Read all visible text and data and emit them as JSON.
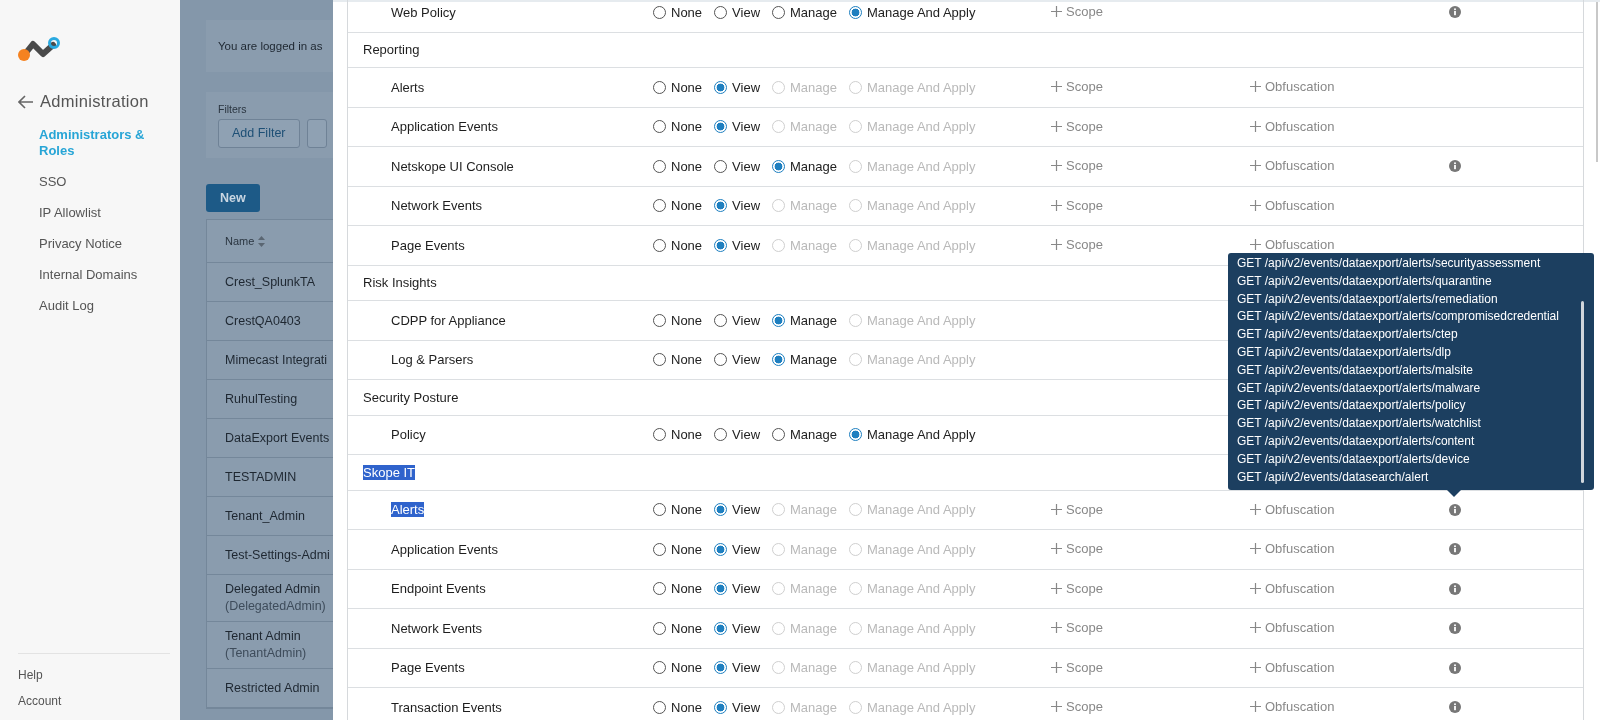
{
  "sidebar": {
    "title": "Administration",
    "items": [
      {
        "label": "Administrators & Roles",
        "selected": true
      },
      {
        "label": "SSO",
        "selected": false
      },
      {
        "label": "IP Allowlist",
        "selected": false
      },
      {
        "label": "Privacy Notice",
        "selected": false
      },
      {
        "label": "Internal Domains",
        "selected": false
      },
      {
        "label": "Audit Log",
        "selected": false
      }
    ],
    "footer_links": [
      "Help",
      "Account"
    ]
  },
  "background_page": {
    "login_notice": "You are logged in as",
    "filters_label": "Filters",
    "add_filter_button": "Add Filter",
    "new_button": "New",
    "name_column": "Name",
    "rows": [
      [
        "Crest_SplunkTA"
      ],
      [
        "CrestQA0403"
      ],
      [
        "Mimecast Integrati"
      ],
      [
        "RuhulTesting"
      ],
      [
        "DataExport Events"
      ],
      [
        "TESTADMIN"
      ],
      [
        "Tenant_Admin"
      ],
      [
        "Test-Settings-Admi"
      ],
      [
        "Delegated Admin",
        "(DelegatedAdmin)"
      ],
      [
        "Tenant Admin",
        "(TenantAdmin)"
      ],
      [
        "Restricted Admin"
      ]
    ]
  },
  "permissions": [
    {
      "kind": "item",
      "label": "Web Policy",
      "highlighted": false,
      "options": [
        {
          "label": "None",
          "selected": false,
          "disabled": false
        },
        {
          "label": "View",
          "selected": false,
          "disabled": false
        },
        {
          "label": "Manage",
          "selected": false,
          "disabled": false
        },
        {
          "label": "Manage And Apply",
          "selected": true,
          "disabled": false
        }
      ],
      "scope": "Scope",
      "info": true
    },
    {
      "kind": "group",
      "label": "Reporting",
      "highlighted": false
    },
    {
      "kind": "item",
      "label": "Alerts",
      "highlighted": false,
      "options": [
        {
          "label": "None",
          "selected": false,
          "disabled": false
        },
        {
          "label": "View",
          "selected": true,
          "disabled": false
        },
        {
          "label": "Manage",
          "selected": false,
          "disabled": true
        },
        {
          "label": "Manage And Apply",
          "selected": false,
          "disabled": true
        }
      ],
      "scope": "Scope",
      "obfuscation": "Obfuscation",
      "info": false
    },
    {
      "kind": "item",
      "label": "Application Events",
      "highlighted": false,
      "options": [
        {
          "label": "None",
          "selected": false,
          "disabled": false
        },
        {
          "label": "View",
          "selected": true,
          "disabled": false
        },
        {
          "label": "Manage",
          "selected": false,
          "disabled": true
        },
        {
          "label": "Manage And Apply",
          "selected": false,
          "disabled": true
        }
      ],
      "scope": "Scope",
      "obfuscation": "Obfuscation",
      "info": false
    },
    {
      "kind": "item",
      "label": "Netskope UI Console",
      "highlighted": false,
      "options": [
        {
          "label": "None",
          "selected": false,
          "disabled": false
        },
        {
          "label": "View",
          "selected": false,
          "disabled": false
        },
        {
          "label": "Manage",
          "selected": true,
          "disabled": false
        },
        {
          "label": "Manage And Apply",
          "selected": false,
          "disabled": true
        }
      ],
      "scope": "Scope",
      "obfuscation": "Obfuscation",
      "info": true
    },
    {
      "kind": "item",
      "label": "Network Events",
      "highlighted": false,
      "options": [
        {
          "label": "None",
          "selected": false,
          "disabled": false
        },
        {
          "label": "View",
          "selected": true,
          "disabled": false
        },
        {
          "label": "Manage",
          "selected": false,
          "disabled": true
        },
        {
          "label": "Manage And Apply",
          "selected": false,
          "disabled": true
        }
      ],
      "scope": "Scope",
      "obfuscation": "Obfuscation",
      "info": false
    },
    {
      "kind": "item",
      "label": "Page Events",
      "highlighted": false,
      "options": [
        {
          "label": "None",
          "selected": false,
          "disabled": false
        },
        {
          "label": "View",
          "selected": true,
          "disabled": false
        },
        {
          "label": "Manage",
          "selected": false,
          "disabled": true
        },
        {
          "label": "Manage And Apply",
          "selected": false,
          "disabled": true
        }
      ],
      "scope": "Scope",
      "obfuscation": "Obfuscation",
      "info": false
    },
    {
      "kind": "group",
      "label": "Risk Insights",
      "highlighted": false
    },
    {
      "kind": "item",
      "label": "CDPP for Appliance",
      "highlighted": false,
      "options": [
        {
          "label": "None",
          "selected": false,
          "disabled": false
        },
        {
          "label": "View",
          "selected": false,
          "disabled": false
        },
        {
          "label": "Manage",
          "selected": true,
          "disabled": false
        },
        {
          "label": "Manage And Apply",
          "selected": false,
          "disabled": true
        }
      ],
      "info": false
    },
    {
      "kind": "item",
      "label": "Log & Parsers",
      "highlighted": false,
      "options": [
        {
          "label": "None",
          "selected": false,
          "disabled": false
        },
        {
          "label": "View",
          "selected": false,
          "disabled": false
        },
        {
          "label": "Manage",
          "selected": true,
          "disabled": false
        },
        {
          "label": "Manage And Apply",
          "selected": false,
          "disabled": true
        }
      ],
      "info": false
    },
    {
      "kind": "group",
      "label": "Security Posture",
      "highlighted": false
    },
    {
      "kind": "item",
      "label": "Policy",
      "highlighted": false,
      "options": [
        {
          "label": "None",
          "selected": false,
          "disabled": false
        },
        {
          "label": "View",
          "selected": false,
          "disabled": false
        },
        {
          "label": "Manage",
          "selected": false,
          "disabled": false
        },
        {
          "label": "Manage And Apply",
          "selected": true,
          "disabled": false
        }
      ],
      "info": false
    },
    {
      "kind": "group",
      "label": "Skope IT",
      "highlighted": true
    },
    {
      "kind": "item",
      "label": "Alerts",
      "highlighted": true,
      "options": [
        {
          "label": "None",
          "selected": false,
          "disabled": false
        },
        {
          "label": "View",
          "selected": true,
          "disabled": false
        },
        {
          "label": "Manage",
          "selected": false,
          "disabled": true
        },
        {
          "label": "Manage And Apply",
          "selected": false,
          "disabled": true
        }
      ],
      "scope": "Scope",
      "obfuscation": "Obfuscation",
      "info": true
    },
    {
      "kind": "item",
      "label": "Application Events",
      "highlighted": false,
      "options": [
        {
          "label": "None",
          "selected": false,
          "disabled": false
        },
        {
          "label": "View",
          "selected": true,
          "disabled": false
        },
        {
          "label": "Manage",
          "selected": false,
          "disabled": true
        },
        {
          "label": "Manage And Apply",
          "selected": false,
          "disabled": true
        }
      ],
      "scope": "Scope",
      "obfuscation": "Obfuscation",
      "info": true
    },
    {
      "kind": "item",
      "label": "Endpoint Events",
      "highlighted": false,
      "options": [
        {
          "label": "None",
          "selected": false,
          "disabled": false
        },
        {
          "label": "View",
          "selected": true,
          "disabled": false
        },
        {
          "label": "Manage",
          "selected": false,
          "disabled": true
        },
        {
          "label": "Manage And Apply",
          "selected": false,
          "disabled": true
        }
      ],
      "scope": "Scope",
      "obfuscation": "Obfuscation",
      "info": true
    },
    {
      "kind": "item",
      "label": "Network Events",
      "highlighted": false,
      "options": [
        {
          "label": "None",
          "selected": false,
          "disabled": false
        },
        {
          "label": "View",
          "selected": true,
          "disabled": false
        },
        {
          "label": "Manage",
          "selected": false,
          "disabled": true
        },
        {
          "label": "Manage And Apply",
          "selected": false,
          "disabled": true
        }
      ],
      "scope": "Scope",
      "obfuscation": "Obfuscation",
      "info": true
    },
    {
      "kind": "item",
      "label": "Page Events",
      "highlighted": false,
      "options": [
        {
          "label": "None",
          "selected": false,
          "disabled": false
        },
        {
          "label": "View",
          "selected": true,
          "disabled": false
        },
        {
          "label": "Manage",
          "selected": false,
          "disabled": true
        },
        {
          "label": "Manage And Apply",
          "selected": false,
          "disabled": true
        }
      ],
      "scope": "Scope",
      "obfuscation": "Obfuscation",
      "info": true
    },
    {
      "kind": "item",
      "label": "Transaction Events",
      "highlighted": false,
      "options": [
        {
          "label": "None",
          "selected": false,
          "disabled": false
        },
        {
          "label": "View",
          "selected": true,
          "disabled": false
        },
        {
          "label": "Manage",
          "selected": false,
          "disabled": true
        },
        {
          "label": "Manage And Apply",
          "selected": false,
          "disabled": true
        }
      ],
      "scope": "Scope",
      "obfuscation": "Obfuscation",
      "info": true
    }
  ],
  "tooltip": {
    "lines": [
      "GET /api/v2/events/dataexport/alerts/securityassessment",
      "GET /api/v2/events/dataexport/alerts/quarantine",
      "GET /api/v2/events/dataexport/alerts/remediation",
      "GET /api/v2/events/dataexport/alerts/compromisedcredential",
      "GET /api/v2/events/dataexport/alerts/ctep",
      "GET /api/v2/events/dataexport/alerts/dlp",
      "GET /api/v2/events/dataexport/alerts/malsite",
      "GET /api/v2/events/dataexport/alerts/malware",
      "GET /api/v2/events/dataexport/alerts/policy",
      "GET /api/v2/events/dataexport/alerts/watchlist",
      "GET /api/v2/events/dataexport/alerts/content",
      "GET /api/v2/events/dataexport/alerts/device",
      "GET /api/v2/events/datasearch/alert"
    ]
  }
}
